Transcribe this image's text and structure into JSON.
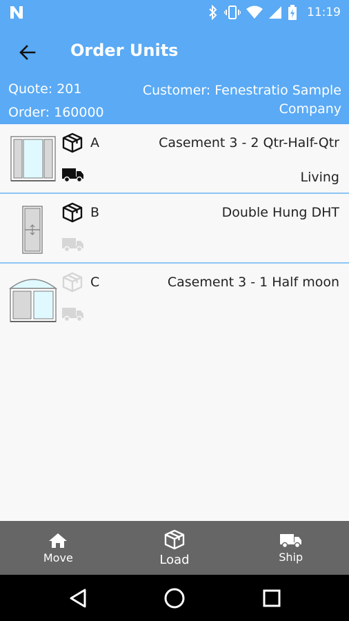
{
  "status_bar": {
    "time": "11:19",
    "icons": [
      "n-notification-icon",
      "bluetooth-icon",
      "vibrate-icon",
      "wifi-icon",
      "signal-icon",
      "battery-icon"
    ]
  },
  "app_bar": {
    "title": "Order Units",
    "quote": "Quote: 201",
    "order": "Order: 160000",
    "customer": "Customer: Fenestratio Sample Company"
  },
  "units": [
    {
      "letter": "A",
      "description": "Casement 3 - 2 Qtr-Half-Qtr",
      "room": "Living",
      "box_active": true,
      "truck_active": true
    },
    {
      "letter": "B",
      "description": "Double Hung DHT",
      "room": "",
      "box_active": true,
      "truck_active": false
    },
    {
      "letter": "C",
      "description": "Casement 3 - 1 Half moon",
      "room": "",
      "box_active": false,
      "truck_active": false
    }
  ],
  "actions": {
    "move": "Move",
    "load": "Load",
    "ship": "Ship"
  },
  "colors": {
    "primary": "#5aaaf5",
    "divider": "#8dc4f4",
    "action_bar": "#666666",
    "inactive_icon": "#d6d6d6"
  }
}
